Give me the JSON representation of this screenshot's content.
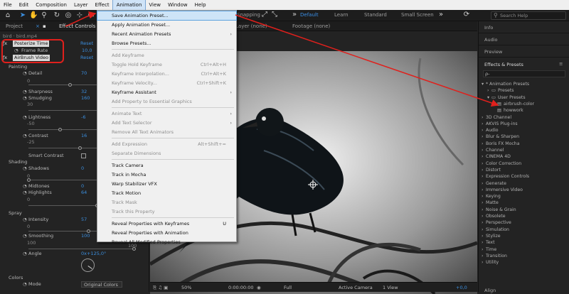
{
  "menubar": {
    "items": [
      "File",
      "Edit",
      "Composition",
      "Layer",
      "Effect",
      "Animation",
      "View",
      "Window",
      "Help"
    ]
  },
  "toolbar": {
    "snapping_label": "Snapping",
    "workspaces": [
      "Default",
      "Learn",
      "Standard",
      "Small Screen"
    ],
    "search_placeholder": "Search Help"
  },
  "left_panel": {
    "tabs": [
      "Project",
      "Effect Controls bird"
    ],
    "layer_header": "bird · bird.mp4",
    "effects": [
      {
        "name": "Posterize Time",
        "reset": "Reset"
      },
      {
        "name": "Frame Rate",
        "value": "10,0"
      },
      {
        "name": "AirBrush Video",
        "reset": "Reset"
      }
    ],
    "groups": {
      "painting": "Painting",
      "shading": "Shading",
      "spray": "Spray",
      "colors": "Colors"
    },
    "params": [
      {
        "label": "Detail",
        "value": "70"
      },
      {
        "label": "Sharpness",
        "value": "32"
      },
      {
        "label": "Smudging",
        "value": "160"
      },
      {
        "label": "Lightness",
        "value": "-6"
      },
      {
        "label": "Contrast",
        "value": "16"
      },
      {
        "label": "Smart Contrast",
        "value": ""
      },
      {
        "label": "Shadows",
        "value": "0"
      },
      {
        "label": "Midtones",
        "value": "0"
      },
      {
        "label": "Highlights",
        "value": "64"
      },
      {
        "label": "Intensity",
        "value": "57"
      },
      {
        "label": "Smoothing",
        "value": "100"
      },
      {
        "label": "Angle",
        "value": "0x+125,0°"
      },
      {
        "label": "Mode",
        "value": "Original Colors"
      }
    ],
    "range_labels": {
      "zero": "0",
      "thirty": "30",
      "minus_fifty": "-50",
      "minus_twentyfive": "-25",
      "one_hundred": "100",
      "one_hundred_b": "100",
      "zero_b": "0",
      "zero_c": "0",
      "zero_d": "0"
    }
  },
  "animation_menu": {
    "items": [
      {
        "label": "Save Animation Preset...",
        "enabled": true,
        "selected": true
      },
      {
        "label": "Apply Animation Preset...",
        "enabled": true
      },
      {
        "label": "Recent Animation Presets",
        "enabled": true,
        "submenu": true
      },
      {
        "label": "Browse Presets...",
        "enabled": true
      },
      {
        "label": "Add Keyframe",
        "enabled": false
      },
      {
        "label": "Toggle Hold Keyframe",
        "enabled": false,
        "shortcut": "Ctrl+Alt+H"
      },
      {
        "label": "Keyframe Interpolation...",
        "enabled": false,
        "shortcut": "Ctrl+Alt+K"
      },
      {
        "label": "Keyframe Velocity...",
        "enabled": false,
        "shortcut": "Ctrl+Shift+K"
      },
      {
        "label": "Keyframe Assistant",
        "enabled": true,
        "submenu": true
      },
      {
        "label": "Add Property to Essential Graphics",
        "enabled": false
      },
      {
        "label": "Animate Text",
        "enabled": false,
        "submenu": true
      },
      {
        "label": "Add Text Selector",
        "enabled": false,
        "submenu": true
      },
      {
        "label": "Remove All Text Animators",
        "enabled": false
      },
      {
        "label": "Add Expression",
        "enabled": false,
        "shortcut": "Alt+Shift+="
      },
      {
        "label": "Separate Dimensions",
        "enabled": false
      },
      {
        "label": "Track Camera",
        "enabled": true
      },
      {
        "label": "Track in Mocha",
        "enabled": true
      },
      {
        "label": "Warp Stabilizer VFX",
        "enabled": true
      },
      {
        "label": "Track Motion",
        "enabled": true
      },
      {
        "label": "Track Mask",
        "enabled": false
      },
      {
        "label": "Track this Property",
        "enabled": false
      },
      {
        "label": "Reveal Properties with Keyframes",
        "enabled": true,
        "shortcut": "U"
      },
      {
        "label": "Reveal Properties with Animation",
        "enabled": true
      },
      {
        "label": "Reveal All Modified Properties",
        "enabled": true
      }
    ]
  },
  "composition": {
    "layer_label": "Layer (none)",
    "footage_label": "Footage (none)",
    "zoom": "50%",
    "timecode": "0:00:00:00",
    "resolution": "Full",
    "camera": "Active Camera",
    "views": "1 View",
    "exposure": "+0,0"
  },
  "right_panel": {
    "sections": [
      "Info",
      "Audio",
      "Preview",
      "Effects & Presets"
    ],
    "search_placeholder": "ρ-",
    "tree": [
      {
        "label": "* Animation Presets",
        "indent": 0
      },
      {
        "label": "Presets",
        "indent": 1
      },
      {
        "label": "User Presets",
        "indent": 1
      },
      {
        "label": "airbrush-color",
        "indent": 2
      },
      {
        "label": "howwork",
        "indent": 2
      },
      {
        "label": "3D Channel",
        "indent": 0
      },
      {
        "label": "AKVIS Plug-ins",
        "indent": 0
      },
      {
        "label": "Audio",
        "indent": 0
      },
      {
        "label": "Blur & Sharpen",
        "indent": 0
      },
      {
        "label": "Boris FX Mocha",
        "indent": 0
      },
      {
        "label": "Channel",
        "indent": 0
      },
      {
        "label": "CINEMA 4D",
        "indent": 0
      },
      {
        "label": "Color Correction",
        "indent": 0
      },
      {
        "label": "Distort",
        "indent": 0
      },
      {
        "label": "Expression Controls",
        "indent": 0
      },
      {
        "label": "Generate",
        "indent": 0
      },
      {
        "label": "Immersive Video",
        "indent": 0
      },
      {
        "label": "Keying",
        "indent": 0
      },
      {
        "label": "Matte",
        "indent": 0
      },
      {
        "label": "Noise & Grain",
        "indent": 0
      },
      {
        "label": "Obsolete",
        "indent": 0
      },
      {
        "label": "Perspective",
        "indent": 0
      },
      {
        "label": "Simulation",
        "indent": 0
      },
      {
        "label": "Stylize",
        "indent": 0
      },
      {
        "label": "Text",
        "indent": 0
      },
      {
        "label": "Time",
        "indent": 0
      },
      {
        "label": "Transition",
        "indent": 0
      },
      {
        "label": "Utility",
        "indent": 0
      }
    ],
    "bottom_label": "Align"
  },
  "colors": {
    "accent": "#3b8ede",
    "annotation_red": "#e0201c",
    "menu_bg": "#f0f0f0",
    "menu_highlight": "#cde4f7"
  }
}
